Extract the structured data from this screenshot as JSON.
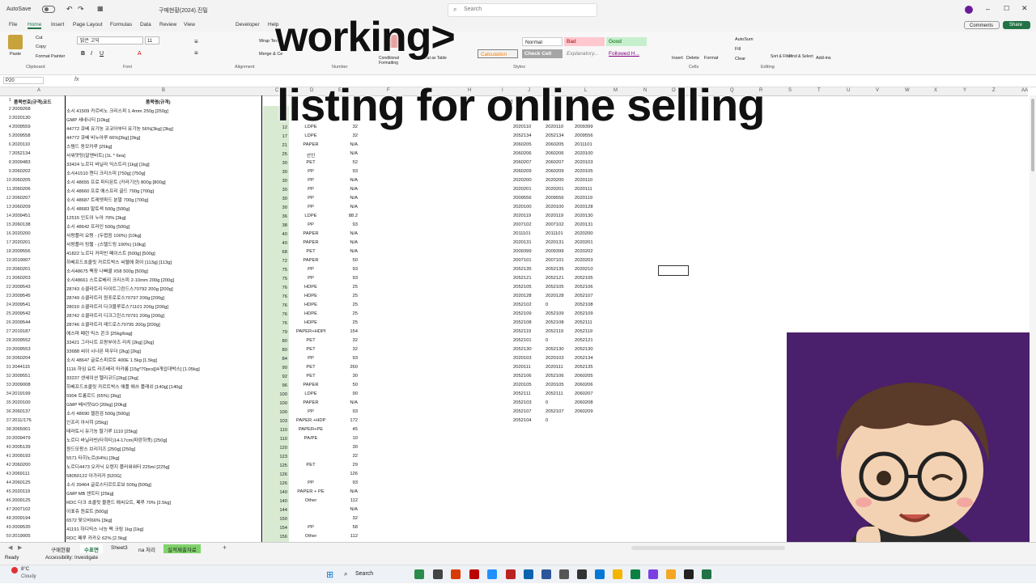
{
  "titlebar": {
    "autosave": "AutoSave",
    "filename": "구매현황(2024).진밀",
    "search_placeholder": "Search"
  },
  "menu": [
    "File",
    "Home",
    "Insert",
    "Page Layout",
    "Formulas",
    "Data",
    "Review",
    "View",
    "Developer",
    "Help"
  ],
  "buttons": {
    "comments": "Comments",
    "share": "Share"
  },
  "ribbon": {
    "paste": "Paste",
    "cut": "Cut",
    "copy": "Copy",
    "format_painter": "Format Painter",
    "font_name": "맑은 고딕",
    "font_size": "11",
    "wrap": "Wrap Text",
    "merge": "Merge & Ce",
    "conditional": "Conditional Formatting",
    "format_table": "Format as Table",
    "styles": {
      "normal": "Normal",
      "bad": "Bad",
      "good": "Good",
      "calculation": "Calculation",
      "check_cell": "Check Cell",
      "explanatory": "Explanatory...",
      "followed": "Followed H..."
    },
    "insert": "Insert",
    "delete": "Delete",
    "format": "Format",
    "autosum": "AutoSum",
    "fill": "Fill",
    "clear": "Clear",
    "sort": "Sort & Filter",
    "find": "Find & Select",
    "addins": "Add-ins",
    "groups": {
      "clipboard": "Clipboard",
      "font": "Font",
      "alignment": "Alignment",
      "number": "Number",
      "styles": "Styles",
      "cells": "Cells",
      "editing": "Editing"
    }
  },
  "namebox": "P20",
  "fx": "fx",
  "overlay": {
    "line1": "working>",
    "line2": "listing for online selling"
  },
  "columns": [
    "A",
    "B",
    "C",
    "D",
    "E",
    "F",
    "G",
    "H",
    "I",
    "J",
    "K",
    "L",
    "M",
    "N",
    "O",
    "P",
    "Q",
    "R",
    "S",
    "T",
    "U",
    "V",
    "W",
    "X",
    "Y",
    "Z",
    "AA",
    "AB"
  ],
  "header_row": {
    "b": "품목번호(규격)코드",
    "c": "품목명(규격)",
    "k": "매입"
  },
  "rows": [
    {
      "n": "2",
      "a": "2009268",
      "c": "소시 41509 카르비노 크리스피 1.4mm 250g [250g]",
      "d": "",
      "e": "",
      "f": "",
      "k": "",
      "l": "",
      "m": ""
    },
    {
      "n": "3",
      "a": "2020130",
      "c": "GMP 세네니티 [10kg]",
      "d": "",
      "e": "",
      "f": "",
      "k": "",
      "l": "",
      "m": ""
    },
    {
      "n": "4",
      "a": "2009559",
      "c": "44772 큐베 유기농 코코아부터 유기농 56%[3kg] [3kg]",
      "d": "12",
      "e": "LDPE",
      "f": "32",
      "k": "2020110",
      "l": "2020110",
      "m": "2009399"
    },
    {
      "n": "5",
      "a": "2009558",
      "c": "44772 큐베 비누아루 66%[3kg] [3kg]",
      "d": "17",
      "e": "LDPE",
      "f": "32",
      "k": "2052134",
      "l": "2052134",
      "m": "2009556"
    },
    {
      "n": "6",
      "a": "2020110",
      "c": "스템드 동모카루 [25kg]",
      "d": "21",
      "e": "PAPER",
      "f": "N/A",
      "k": "2060205",
      "l": "2060205",
      "m": "2011101"
    },
    {
      "n": "7",
      "a": "2052134",
      "c": "사워맛탕(알엔비트) [1L * 6ea]",
      "d": "25",
      "e": "선인",
      "f": "N/A",
      "k": "2060206",
      "l": "2060206",
      "m": "2020100"
    },
    {
      "n": "8",
      "a": "2009483",
      "c": "33424 노르디 바닐라 익스트리 [1kg] [1kg]",
      "d": "30",
      "e": "PET",
      "f": "52",
      "k": "2060207",
      "l": "2060207",
      "m": "2020103"
    },
    {
      "n": "9",
      "a": "2060202",
      "c": "소시41510 캔디 크리스피 [750g] [750g]",
      "d": "30",
      "e": "PP",
      "f": "93",
      "k": "2060209",
      "l": "2060209",
      "m": "2020105"
    },
    {
      "n": "10",
      "a": "2060205",
      "c": "소시 48655 프로 피티몬트 (카라기산) 800g [800g]",
      "d": "30",
      "e": "PP",
      "f": "N/A",
      "k": "2020200",
      "l": "2020200",
      "m": "2020110"
    },
    {
      "n": "11",
      "a": "2060206",
      "c": "소시 48660 프로 에스프리 골드 700g [700g]",
      "d": "30",
      "e": "PP",
      "f": "N/A",
      "k": "2020201",
      "l": "2020201",
      "m": "2020111"
    },
    {
      "n": "12",
      "a": "2060207",
      "c": "소시 48687 트레엣파드 분말 700g [700g]",
      "d": "30",
      "e": "PP",
      "f": "N/A",
      "k": "2009556",
      "l": "2009556",
      "m": "2020119"
    },
    {
      "n": "13",
      "a": "2060209",
      "c": "소시 48683 말토색 500g [500g]",
      "d": "30",
      "e": "PP",
      "f": "N/A",
      "k": "2020100",
      "l": "2020100",
      "m": "2020128"
    },
    {
      "n": "14",
      "a": "2009451",
      "c": "12515 인도이 누아 70% [3kg]",
      "d": "36",
      "e": "LDPE",
      "f": "88.2",
      "k": "2020119",
      "l": "2020119",
      "m": "2020130"
    },
    {
      "n": "15",
      "a": "2060138",
      "c": "소시 48642 프라인 500g [500g]",
      "d": "38",
      "e": "PP",
      "f": "93",
      "k": "2007102",
      "l": "2007102",
      "m": "2020131"
    },
    {
      "n": "16",
      "a": "2020200",
      "c": "사랑플러 요령 - (두렵음 100%) [10kg]",
      "d": "40",
      "e": "PAPER",
      "f": "N/A",
      "k": "2011101",
      "l": "2011101",
      "m": "2020200"
    },
    {
      "n": "17",
      "a": "2020201",
      "c": "사랑플러 링웹 - (스텔드링 100%) [10kg]",
      "d": "40",
      "e": "PAPER",
      "f": "N/A",
      "k": "2020131",
      "l": "2020131",
      "m": "2020201"
    },
    {
      "n": "18",
      "a": "2009556",
      "c": "41822 노르디 커피빈 페이스트 [500g] [500g]",
      "d": "68",
      "e": "PET",
      "f": "N/A",
      "k": "2009399",
      "l": "2009399",
      "m": "2020202"
    },
    {
      "n": "19",
      "a": "2019007",
      "c": "하베프드초콜릿 카르트박스 씨웹에 화이 [113g] [113g]",
      "d": "72",
      "e": "PAPER",
      "f": "50",
      "k": "2007101",
      "l": "2007101",
      "m": "2020203"
    },
    {
      "n": "20",
      "a": "2060201",
      "c": "소시48675 팩장 나빠클 X58 500g [500g]",
      "d": "75",
      "e": "PP",
      "f": "93",
      "k": "2052135",
      "l": "2052135",
      "m": "2020210"
    },
    {
      "n": "21",
      "a": "2060203",
      "c": "소시48661 스트로베리 크리스피 2-10mm 200g [200g]",
      "d": "75",
      "e": "PP",
      "f": "93",
      "k": "2052121",
      "l": "2052121",
      "m": "2052105"
    },
    {
      "n": "22",
      "a": "2009543",
      "c": "28743 소콜라트리 타이트그린드스70792 200g [200g]",
      "d": "76",
      "e": "HDPE",
      "f": "25",
      "k": "2052105",
      "l": "2052105",
      "m": "2052106"
    },
    {
      "n": "23",
      "a": "2009545",
      "c": "28749 소콜라트리 원포로로스70797 200g [200g]",
      "d": "76",
      "e": "HDPE",
      "f": "25",
      "k": "2020128",
      "l": "2020128",
      "m": "2052107"
    },
    {
      "n": "24",
      "a": "2009541",
      "c": "28010 소콜라트리 다크블루로스71101 200g [200g]",
      "d": "76",
      "e": "HDPE",
      "f": "25",
      "k": "2052102",
      "l": "0",
      "m": "2052108"
    },
    {
      "n": "25",
      "a": "2009542",
      "c": "28742 소콜라트리 디크그린스70791 200g [200g]",
      "d": "76",
      "e": "HDPE",
      "f": "25",
      "k": "2052109",
      "l": "2052109",
      "m": "2052109"
    },
    {
      "n": "26",
      "a": "2009544",
      "c": "28746 소콜라트리 레드로스70795 200g [200g]",
      "d": "76",
      "e": "HDPE",
      "f": "25",
      "k": "2052108",
      "l": "2052108",
      "m": "2052111"
    },
    {
      "n": "27",
      "a": "2019187",
      "c": "에스파 페런 믹스 콘크 [25kg/bag]",
      "d": "79",
      "e": "PAPER+HDPE",
      "f": "154",
      "k": "2052119",
      "l": "2052119",
      "m": "2052119"
    },
    {
      "n": "28",
      "a": "2009552",
      "c": "33421 그라니트 프랑부아즈 리치 [2kg] [2kg]",
      "d": "80",
      "e": "PET",
      "f": "32",
      "k": "2052101",
      "l": "0",
      "m": "2052121"
    },
    {
      "n": "29",
      "a": "2009553",
      "c": "33688 씨이 시나몬 파우더 [2kg] [2kg]",
      "d": "80",
      "e": "PET",
      "f": "32",
      "k": "2052130",
      "l": "2052130",
      "m": "2052130"
    },
    {
      "n": "30",
      "a": "2060204",
      "c": "소시 48647 글로스피르트 400E 1.5kg [1.5kg]",
      "d": "84",
      "e": "PP",
      "f": "93",
      "k": "2020103",
      "l": "2020103",
      "m": "2052134"
    },
    {
      "n": "31",
      "a": "2044115",
      "c": "1116 하임 요트 라즈베리 마카롱 [15g*70pcs][4개입대박스] [1.05kg]",
      "d": "90",
      "e": "PET",
      "f": "260",
      "k": "2020111",
      "l": "2020111",
      "m": "2052135"
    },
    {
      "n": "32",
      "a": "2009551",
      "c": "33237 센세이션 멜리코드[2kg] [2kg]",
      "d": "92",
      "e": "PET",
      "f": "30",
      "k": "2052106",
      "l": "2052106",
      "m": "2060205"
    },
    {
      "n": "33",
      "a": "2009008",
      "c": "하베프드초콜릿 카르트박스 애플 에쓰 플래쉬 [140g] [140g]",
      "d": "96",
      "e": "PAPER",
      "f": "50",
      "k": "2020105",
      "l": "2020105",
      "m": "2060206"
    },
    {
      "n": "34",
      "a": "2019199",
      "c": "5904 트롱르드 (65%) [3kg]",
      "d": "100",
      "e": "LDPE",
      "f": "90",
      "k": "2052111",
      "l": "2052111",
      "m": "2060207"
    },
    {
      "n": "35",
      "a": "2020100",
      "c": "GMP 베사맛GO [20kg] [20kg]",
      "d": "100",
      "e": "PAPER",
      "f": "N/A",
      "k": "2052103",
      "l": "0",
      "m": "2060208"
    },
    {
      "n": "36",
      "a": "2060137",
      "c": "소시 48690 젤린검 500g [500g]",
      "d": "100",
      "e": "PP",
      "f": "93",
      "k": "2052107",
      "l": "2052107",
      "m": "2060209"
    },
    {
      "n": "37",
      "a": "2011/176",
      "c": "인프리 아사히 [25kg]",
      "d": "103",
      "e": "PAPER +HDPE",
      "f": "172",
      "k": "2052104",
      "l": "0",
      "m": ""
    },
    {
      "n": "38",
      "a": "2065001",
      "c": "테라토시 유기농 딸기루 1110 [25kg]",
      "d": "110",
      "e": "PAPER+PE",
      "f": "45",
      "k": "",
      "l": "",
      "m": ""
    },
    {
      "n": "39",
      "a": "2009479",
      "c": "노르디 바닐라빈(타히티)14-17cm(파란하켓) [250g]",
      "d": "110",
      "e": "PA/PE",
      "f": "10",
      "k": "",
      "l": "",
      "m": ""
    },
    {
      "n": "40",
      "a": "2005139",
      "c": "원드모팡스 브리지즈 [250g] [250g]",
      "d": "120",
      "e": "",
      "f": "30",
      "k": "",
      "l": "",
      "m": ""
    },
    {
      "n": "41",
      "a": "2009193",
      "c": "5571 타히노르(64%) [3kg]",
      "d": "123",
      "e": "",
      "f": "32",
      "k": "",
      "l": "",
      "m": ""
    },
    {
      "n": "42",
      "a": "2060200",
      "c": "노르디4473 오카닉 오렌지 플러워워터 225ml [225g]",
      "d": "125",
      "e": "PET",
      "f": "29",
      "k": "",
      "l": "",
      "m": ""
    },
    {
      "n": "43",
      "a": "2069111",
      "c": "58050122 아가리카 [520G]",
      "d": "126",
      "e": "",
      "f": "126",
      "k": "",
      "l": "",
      "m": ""
    },
    {
      "n": "44",
      "a": "2060125",
      "c": "소시 39464 글로스티르트로보 500g [500g]",
      "d": "126",
      "e": "PP",
      "f": "93",
      "k": "",
      "l": "",
      "m": ""
    },
    {
      "n": "45",
      "a": "2020119",
      "c": "GMP MB 샌트티 [25kg]",
      "d": "140",
      "e": "PAPER + PE",
      "f": "N/A",
      "k": "",
      "l": "",
      "m": ""
    },
    {
      "n": "46",
      "a": "2009125",
      "c": "RDC 다크 초콜릿 블렌드 에씨오트, 페루 70% [2.5kg]",
      "d": "140",
      "e": "Other",
      "f": "112",
      "k": "",
      "l": "",
      "m": ""
    },
    {
      "n": "47",
      "a": "2007102",
      "c": "이표쥬 원료트 [500g]",
      "d": "144",
      "e": "",
      "f": "N/A",
      "k": "",
      "l": "",
      "m": ""
    },
    {
      "n": "48",
      "a": "2009194",
      "c": "6572 맞으비66% [3kg]",
      "d": "150",
      "e": "",
      "f": "32",
      "k": "",
      "l": "",
      "m": ""
    },
    {
      "n": "49",
      "a": "2009535",
      "c": "41191 하디믹스 너능 팩 크림 1kg [1kg]",
      "d": "154",
      "e": "PP",
      "f": "58",
      "k": "",
      "l": "",
      "m": ""
    },
    {
      "n": "50",
      "a": "2019005",
      "c": "RDC 페루 카카오 62% [2.5kg]",
      "d": "156",
      "e": "Other",
      "f": "112",
      "k": "",
      "l": "",
      "m": ""
    }
  ],
  "sheet_tabs": [
    "구매현황",
    "수표면",
    "Sheet3",
    "na 처리",
    "실적제출자료"
  ],
  "status": {
    "ready": "Ready",
    "accessibility": "Accessibility: Investigate"
  },
  "weather": {
    "temp": "8°C",
    "cond": "Cloudy"
  },
  "taskbar_search": "Search",
  "colors": {
    "excel_green": "#217346",
    "avatar_bg": "#4a1f6b",
    "green_cell": "#d9ead3"
  }
}
